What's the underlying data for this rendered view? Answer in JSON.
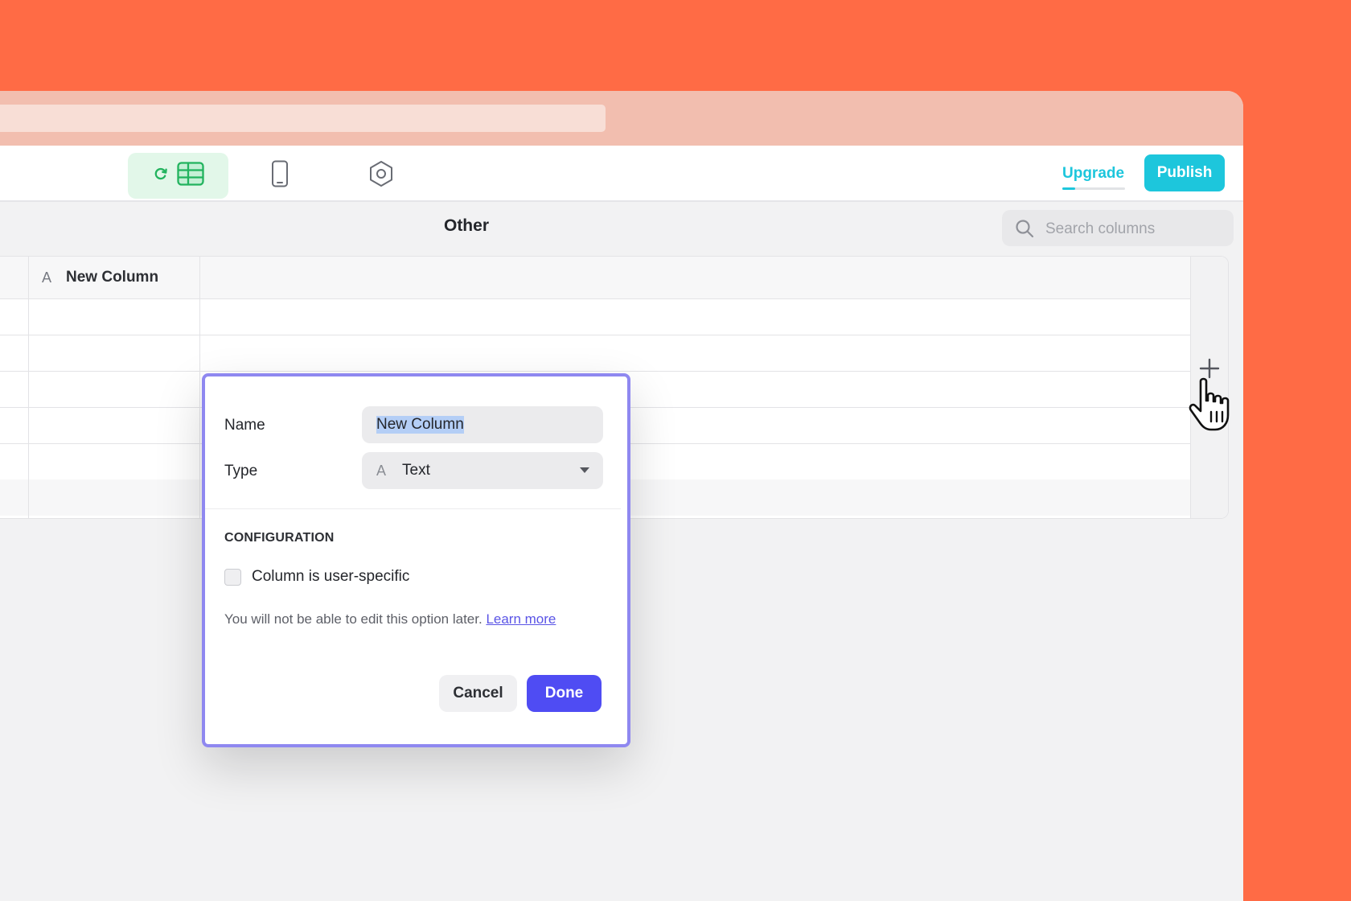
{
  "toolbar": {
    "upgrade_label": "Upgrade",
    "publish_label": "Publish",
    "upgrade_progress_fraction": 0.2
  },
  "table": {
    "title": "Other",
    "search_placeholder": "Search columns",
    "columns": [
      {
        "type_glyph": "A",
        "name": "New Column"
      }
    ],
    "row_count": 6
  },
  "dialog": {
    "name_label": "Name",
    "name_value": "New Column",
    "type_label": "Type",
    "type_glyph": "A",
    "type_value": "Text",
    "section_heading": "CONFIGURATION",
    "checkbox_label": "Column is user-specific",
    "checkbox_checked": false,
    "help_text": "You will not be able to edit this option later.",
    "learn_more_label": "Learn more",
    "cancel_label": "Cancel",
    "done_label": "Done"
  },
  "colors": {
    "backdrop": "#FF6B45",
    "accent_teal": "#1DC6DC",
    "accent_green": "#22B35E",
    "primary_indigo": "#4F4CF3",
    "dialog_focus_border": "#8F88F0"
  },
  "icons": {
    "data_tab": [
      "refresh-icon",
      "table-icon"
    ],
    "layout_tab": "phone-icon",
    "settings_tab": "gear-icon",
    "search": "search-icon",
    "add_column": "plus-icon",
    "type_caret": "chevron-down-icon",
    "cursor": "hand-pointer-icon"
  }
}
